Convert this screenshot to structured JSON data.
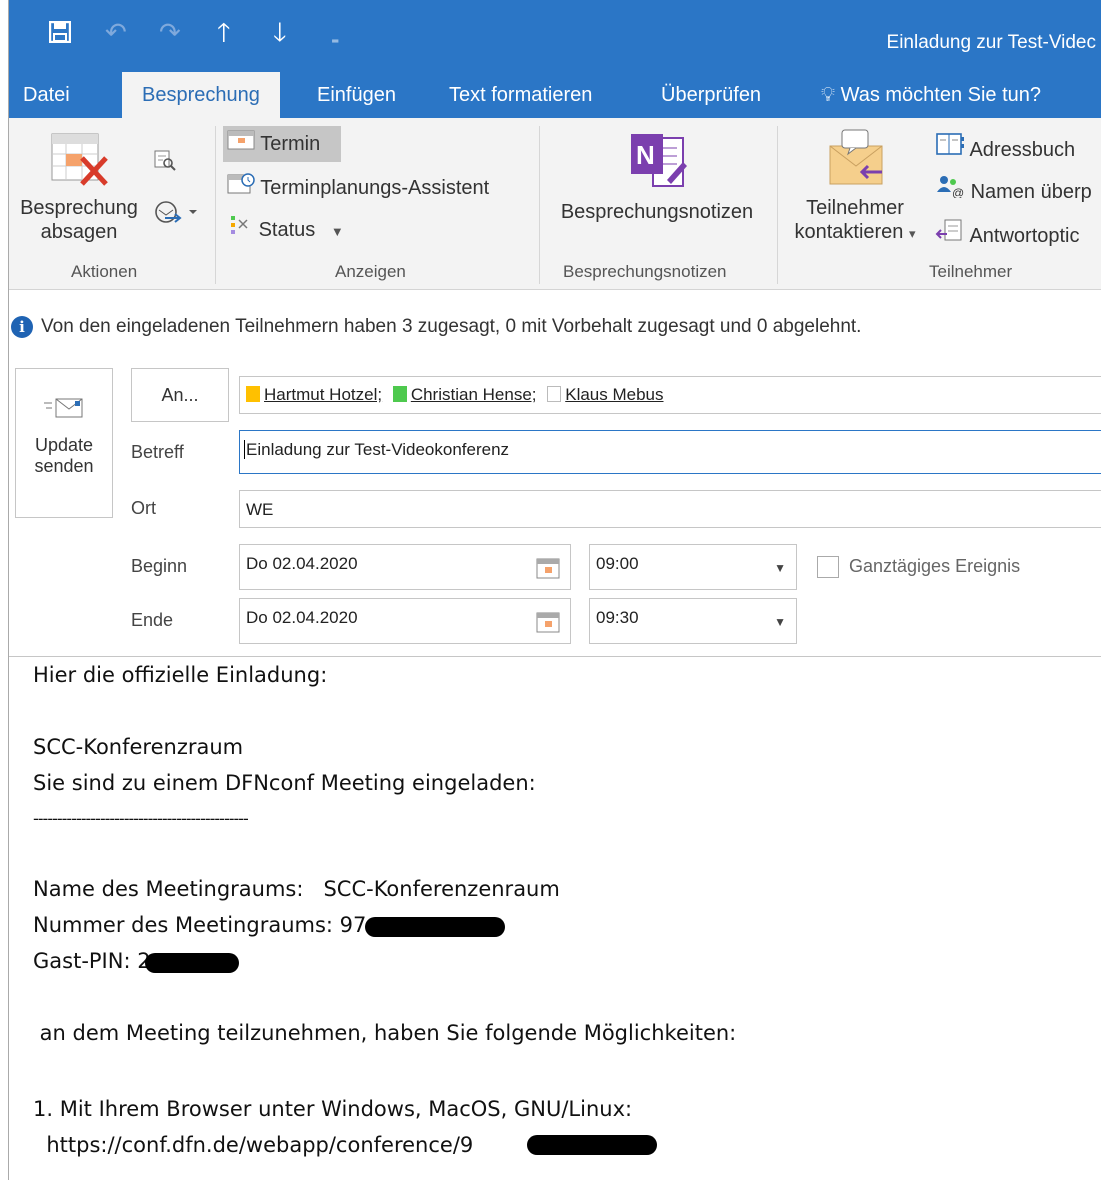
{
  "window": {
    "title": "Einladung zur Test-Videc"
  },
  "tabs": [
    "Datei",
    "Besprechung",
    "Einfügen",
    "Text formatieren",
    "Überprüfen"
  ],
  "tell_me": "Was möchten Sie tun?",
  "ribbon": {
    "aktionen": {
      "label": "Aktionen",
      "cancel_line1": "Besprechung",
      "cancel_line2": "absagen"
    },
    "anzeigen": {
      "label": "Anzeigen",
      "termin": "Termin",
      "assistent": "Terminplanungs-Assistent",
      "status": "Status"
    },
    "notizen": {
      "label": "Besprechungsnotizen",
      "button": "Besprechungsnotizen"
    },
    "teilnehmer": {
      "label": "Teilnehmer",
      "contact_line1": "Teilnehmer",
      "contact_line2": "kontaktieren",
      "adressbuch": "Adressbuch",
      "namen": "Namen überp",
      "antwort": "Antwortoptic"
    }
  },
  "info": "Von den eingeladenen Teilnehmern haben 3 zugesagt, 0 mit Vorbehalt zugesagt und 0 abgelehnt.",
  "form": {
    "send_line1": "Update",
    "send_line2": "senden",
    "an_label": "An...",
    "attendees": [
      {
        "name": "Hartmut Hotzel;",
        "color": "#ffc000"
      },
      {
        "name": "Christian Hense;",
        "color": "#4ec94e"
      },
      {
        "name": "Klaus Mebus",
        "color": "#ffffff"
      }
    ],
    "betreff_label": "Betreff",
    "betreff": "Einladung zur Test-Videokonferenz",
    "ort_label": "Ort",
    "ort": "WE",
    "beginn_label": "Beginn",
    "beginn_date": "Do 02.04.2020",
    "beginn_time": "09:00",
    "ende_label": "Ende",
    "ende_date": "Do 02.04.2020",
    "ende_time": "09:30",
    "allday_label": "Ganztägiges Ereignis"
  },
  "body": {
    "l1": "Hier die offizielle Einladung:",
    "l2": "SCC-Konferenzraum",
    "l3": "Sie sind zu einem DFNconf Meeting eingeladen:",
    "l4": "---------------------------------------------",
    "l5": "Name des Meetingraums:   SCC-Konferenzenraum",
    "l6": "Nummer des Meetingraums: 97",
    "l7": "Gast-PIN: 2",
    "l8": " an dem Meeting teilzunehmen, haben Sie folgende Möglichkeiten:",
    "l9": "1. Mit Ihrem Browser unter Windows, MacOS, GNU/Linux:",
    "l10": "  https://conf.dfn.de/webapp/conference/9"
  },
  "colors": {
    "titlebar": "#2b76c6",
    "ribbon": "#f3f3f3",
    "active_tab_text": "#2b6db5",
    "info_icon": "#1f63b3"
  }
}
